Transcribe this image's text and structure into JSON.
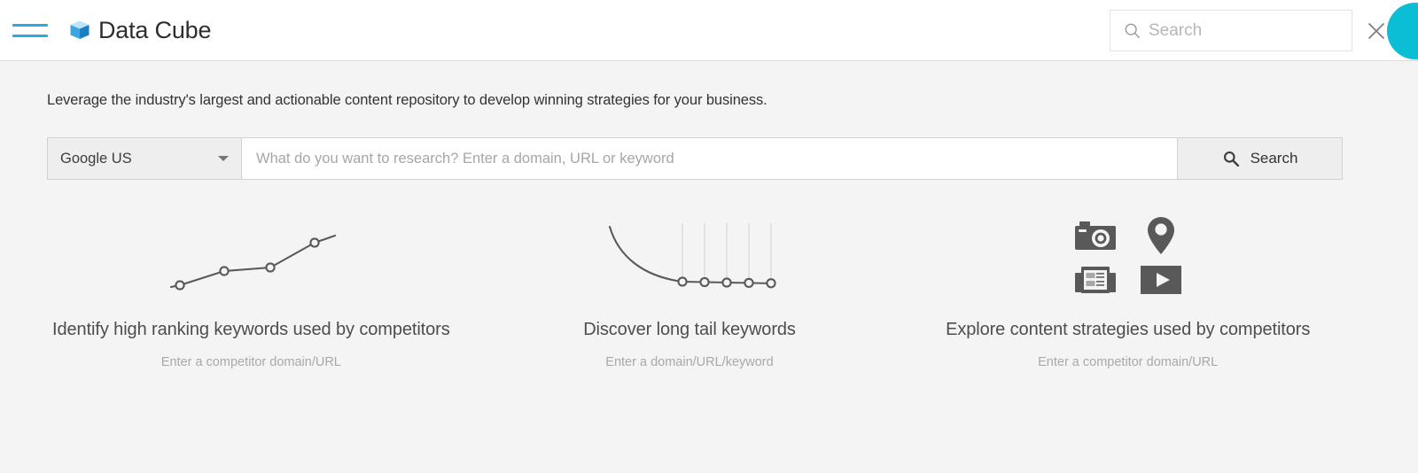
{
  "header": {
    "menu_icon": "hamburger-icon",
    "logo_icon": "cube-logo-icon",
    "title": "Data Cube",
    "search": {
      "icon": "search-icon",
      "placeholder": "Search",
      "value": "",
      "clear_icon": "close-icon"
    },
    "avatar": {
      "name": "user-avatar",
      "color": "#0cbdd6"
    }
  },
  "main": {
    "tagline": "Leverage the industry's largest and actionable content repository to develop winning strategies for your business.",
    "searchbar": {
      "database_selected": "Google US",
      "database_options": [
        "Google US"
      ],
      "dropdown_icon": "chevron-down-icon",
      "input_placeholder": "What do you want to research? Enter a domain, URL or keyword",
      "input_value": "",
      "button_label": "Search",
      "button_icon": "search-icon"
    },
    "features": [
      {
        "art": "rising-line-chart",
        "title": "Identify high ranking keywords used by competitors",
        "subtitle": "Enter a competitor domain/URL"
      },
      {
        "art": "long-tail-curve-chart",
        "title": "Discover long tail keywords",
        "subtitle": "Enter a domain/URL/keyword"
      },
      {
        "art": "content-type-icons",
        "title": "Explore content strategies used by competitors",
        "subtitle": "Enter a competitor domain/URL"
      }
    ]
  },
  "colors": {
    "accent_blue": "#29aae2",
    "avatar_teal": "#0cbdd6",
    "page_background": "#f4f4f4",
    "art_gray": "#595959"
  },
  "chart_data": [
    {
      "type": "line",
      "name": "rising-line-chart",
      "title": "",
      "x": [
        0,
        1,
        2,
        3,
        4,
        5
      ],
      "y": [
        12,
        13,
        25,
        28,
        46,
        55
      ],
      "markers_at": [
        1,
        2,
        3,
        4
      ],
      "grid": false,
      "xlabel": "",
      "ylabel": ""
    },
    {
      "type": "line",
      "name": "long-tail-curve-chart",
      "title": "",
      "x": [
        0,
        1,
        2,
        3,
        4,
        5,
        6,
        7,
        8
      ],
      "y": [
        72,
        40,
        20,
        10,
        8,
        7,
        7,
        6,
        6
      ],
      "markers_at": [
        3,
        4,
        5,
        6,
        7
      ],
      "grid": true,
      "gridlines_x": [
        3,
        4,
        5,
        6,
        7
      ],
      "xlabel": "",
      "ylabel": ""
    }
  ]
}
